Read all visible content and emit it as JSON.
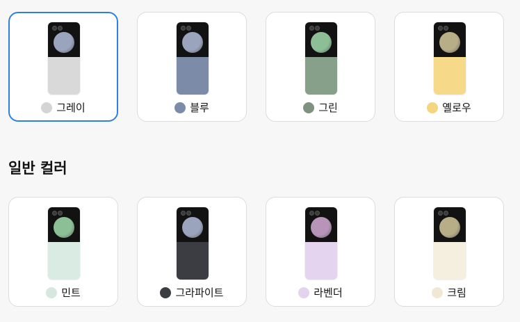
{
  "special_colors": [
    {
      "name": "그레이",
      "swatch": "#d4d4d4",
      "back": "#d9d9d9",
      "disc": "#9aa4bd",
      "selected": true
    },
    {
      "name": "블루",
      "swatch": "#7b8ca8",
      "back": "#7b8ba8",
      "disc": "#9aa4bd",
      "selected": false
    },
    {
      "name": "그린",
      "swatch": "#7f9181",
      "back": "#87a08a",
      "disc": "#8cbf96",
      "selected": false
    },
    {
      "name": "옐로우",
      "swatch": "#f5d57d",
      "back": "#f7d98a",
      "disc": "#b7ad86",
      "selected": false
    }
  ],
  "section_title": "일반 컬러",
  "regular_colors": [
    {
      "name": "민트",
      "swatch": "#d6e7df",
      "back": "#d9ebe2",
      "disc": "#8cbf96",
      "selected": false
    },
    {
      "name": "그라파이트",
      "swatch": "#3a3d42",
      "back": "#3b3d42",
      "disc": "#9aa4bd",
      "selected": false
    },
    {
      "name": "라벤더",
      "swatch": "#e4d3ef",
      "back": "#e4d4ef",
      "disc": "#b794b8",
      "selected": false
    },
    {
      "name": "크림",
      "swatch": "#f1e7d6",
      "back": "#f5efe0",
      "disc": "#b7ad86",
      "selected": false
    }
  ]
}
